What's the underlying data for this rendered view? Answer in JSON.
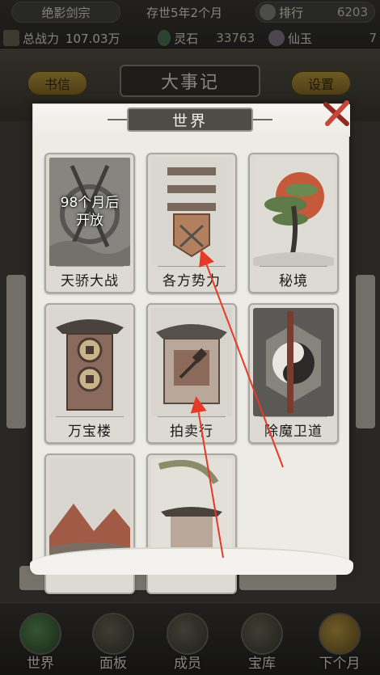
{
  "header": {
    "sect_name": "绝影剑宗",
    "period": "存世5年2个月",
    "rank_label": "排行",
    "rank_value": "6203",
    "power_label": "总战力",
    "power_value": "107.03万",
    "stone_label": "灵石",
    "stone_value": "33763",
    "jade_label": "仙玉",
    "jade_value": "7"
  },
  "toolbar": {
    "letter_label": "书信",
    "events_title": "大事记",
    "settings_label": "设置"
  },
  "modal": {
    "title": "世界",
    "cards": [
      {
        "label": "天骄大战",
        "locked_text": "98个月后\n开放",
        "locked": true
      },
      {
        "label": "各方势力",
        "locked": false
      },
      {
        "label": "秘境",
        "locked": false
      },
      {
        "label": "万宝楼",
        "locked": false
      },
      {
        "label": "拍卖行",
        "locked": false
      },
      {
        "label": "除魔卫道",
        "locked": false
      },
      {
        "label": "",
        "locked": false
      },
      {
        "label": "",
        "locked": false
      }
    ]
  },
  "bottom_nav": {
    "items": [
      {
        "label": "世界"
      },
      {
        "label": "面板"
      },
      {
        "label": "成员"
      },
      {
        "label": "宝库"
      },
      {
        "label": "下个月"
      }
    ]
  },
  "colors": {
    "gold": "#c6a544",
    "modal_bg": "#ecebe6",
    "arrow": "#e53a28"
  }
}
